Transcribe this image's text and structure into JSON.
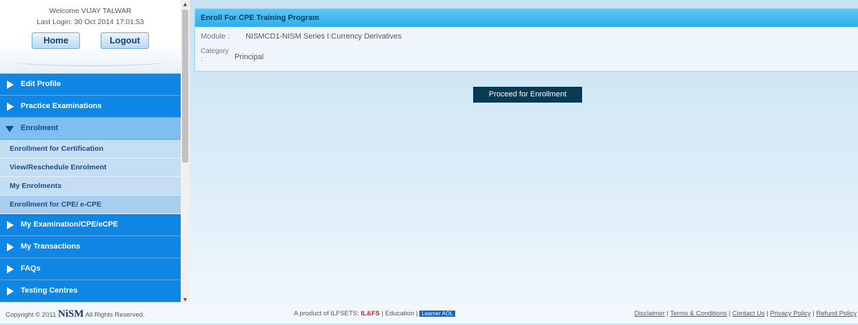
{
  "user": {
    "welcome": "Welcome VIJAY TALWAR",
    "last_login": "Last Login: 30 Oct 2014 17:01:53",
    "home_label": "Home",
    "logout_label": "Logout"
  },
  "sidebar": {
    "items": [
      {
        "label": "Edit Profile"
      },
      {
        "label": "Practice Examinations"
      },
      {
        "label": "Enrolment"
      },
      {
        "label": "My Examination/CPE/eCPE"
      },
      {
        "label": "My Transactions"
      },
      {
        "label": "FAQs"
      },
      {
        "label": "Testing Centres"
      }
    ],
    "sub_items": [
      {
        "label": "Enrollment for Certification"
      },
      {
        "label": "View/Reschedule Enrolment"
      },
      {
        "label": "My Enrolments"
      },
      {
        "label": "Enrollment for CPE/ e-CPE"
      }
    ]
  },
  "panel": {
    "title": "Enroll For CPE Training Program",
    "module_key": "Module :",
    "module_value": "NISMCD1-NISM Series I:Currency Derivatives",
    "category_key": "Category :",
    "category_value": "Principal",
    "proceed_label": "Proceed for Enrollment"
  },
  "footer": {
    "copyright_prefix": "Copyright © 2011",
    "copyright_brand": "NiSM",
    "copyright_suffix": "All Rights Reserved.",
    "product_prefix": "A product of ILFSETS:",
    "product_ilfs": "IL&FS",
    "product_edu": "Education",
    "product_learner": "Learner AOL",
    "links": [
      "Disclaimer",
      "Terms & Conditions",
      "Contact Us",
      "Privacy Policy",
      "Refund Policy"
    ]
  }
}
